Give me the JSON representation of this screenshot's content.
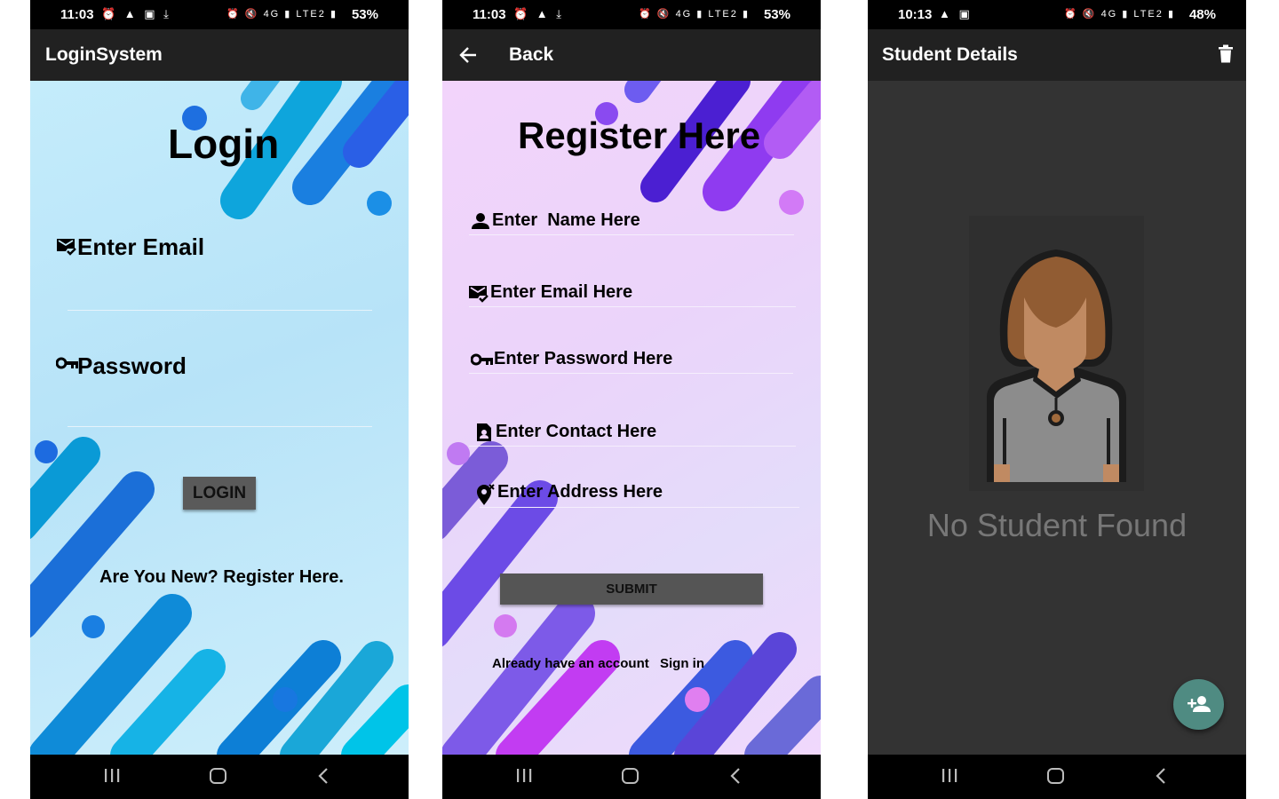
{
  "colors": {
    "appbar": "#212121",
    "statusbar": "#000000",
    "fab": "#4f8b82",
    "login_bg": "#c4ecfb",
    "register_bg": "#f0d4fb",
    "details_bg": "#333333"
  },
  "screens": {
    "login": {
      "status": {
        "time": "11:03",
        "left_icons": "⏰ ▲ ▣ ⤓",
        "right_icons": "⏰ 🔇 4G ▮ LTE2 ▮",
        "battery": "53%"
      },
      "appbar_title": "LoginSystem",
      "heading": "Login",
      "email_label": "Enter Email",
      "email_icon": "mail-check-icon",
      "password_label": "Password",
      "password_icon": "key-icon",
      "login_button": "LOGIN",
      "register_link": "Are You New? Register Here."
    },
    "register": {
      "status": {
        "time": "11:03",
        "left_icons": "⏰ ▲ ⤓",
        "right_icons": "⏰ 🔇 4G ▮ LTE2 ▮",
        "battery": "53%"
      },
      "appbar_title": "Back",
      "heading": "Register Here",
      "fields": [
        {
          "label": "Enter  Name Here",
          "icon": "person-icon"
        },
        {
          "label": "Enter Email Here",
          "icon": "mail-check-icon"
        },
        {
          "label": "Enter Password Here",
          "icon": "key-icon"
        },
        {
          "label": "Enter Contact Here",
          "icon": "contact-card-icon"
        },
        {
          "label": "Enter Address Here",
          "icon": "location-pin-icon"
        }
      ],
      "submit_button": "SUBMIT",
      "account_text": "Already have an account",
      "signin_link": "Sign in"
    },
    "details": {
      "status": {
        "time": "10:13",
        "left_icons": "▲ ▣",
        "right_icons": "⏰ 🔇 4G ▮ LTE2 ▮",
        "battery": "48%"
      },
      "appbar_title": "Student Details",
      "empty_text": "No Student Found",
      "fab_icon": "add-person-icon",
      "delete_icon": "trash-icon"
    }
  }
}
